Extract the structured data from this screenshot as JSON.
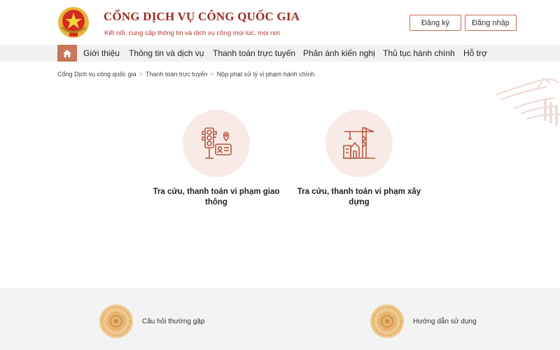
{
  "header": {
    "title": "CỔNG DỊCH VỤ CÔNG QUỐC GIA",
    "subtitle": "Kết nối, cung cấp thông tin và dịch vụ công mọi lúc, mọi nơi",
    "register_label": "Đăng ký",
    "login_label": "Đăng nhập"
  },
  "nav": {
    "home_icon": "home-icon",
    "items": [
      {
        "label": "Giới thiệu"
      },
      {
        "label": "Thông tin và dịch vụ"
      },
      {
        "label": "Thanh toán trực tuyến"
      },
      {
        "label": "Phản ánh kiến nghị"
      },
      {
        "label": "Thủ tục hành chính"
      },
      {
        "label": "Hỗ trợ"
      }
    ]
  },
  "breadcrumb": [
    {
      "label": "Cổng Dịch vụ công quốc gia"
    },
    {
      "label": "Thanh toán trực tuyến"
    },
    {
      "label": "Nộp phạt xử lý vi phạm hành chính"
    }
  ],
  "cards": [
    {
      "label": "Tra cứu, thanh toán vi phạm giao thông",
      "icon": "traffic-light-icon"
    },
    {
      "label": "Tra cứu, thanh toán vi phạm xây dựng",
      "icon": "construction-crane-icon"
    }
  ],
  "footer": {
    "items": [
      {
        "label": "Câu hỏi thường gặp",
        "icon": "seal-icon"
      },
      {
        "label": "Hướng dẫn sử dụng",
        "icon": "seal-icon"
      }
    ]
  },
  "colors": {
    "brand": "#9b2a22",
    "accent": "#c7765b",
    "nav_bg": "#f1f1f1",
    "card_circle": "#f8ebe7"
  }
}
